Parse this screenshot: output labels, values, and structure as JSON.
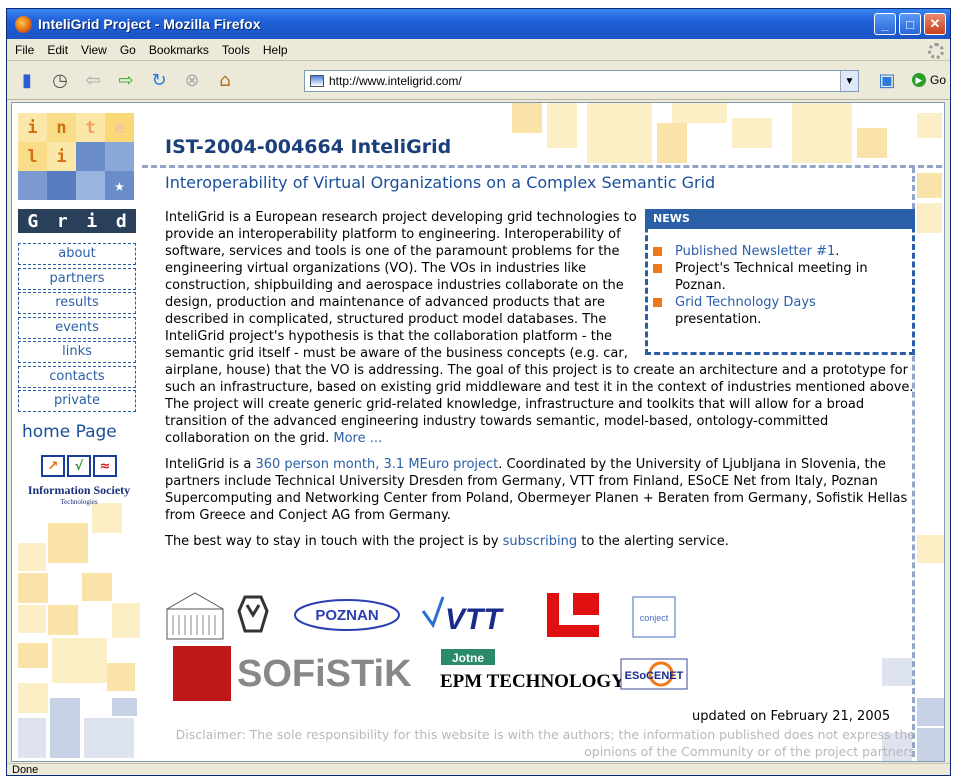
{
  "window": {
    "title": "InteliGrid Project - Mozilla Firefox",
    "min": "_",
    "max": "□",
    "close": "✕"
  },
  "menu": [
    "File",
    "Edit",
    "View",
    "Go",
    "Bookmarks",
    "Tools",
    "Help"
  ],
  "toolbar": {
    "url": "http://www.inteligrid.com/",
    "go_label": "Go"
  },
  "status": "Done",
  "page": {
    "logo_letters": [
      "i",
      "n",
      "t",
      "e",
      "l",
      "i"
    ],
    "grid_letters": [
      "G",
      "r",
      "i",
      "d"
    ],
    "nav": [
      "about",
      "partners",
      "results",
      "events",
      "links",
      "contacts",
      "private"
    ],
    "home": "home Page",
    "ist_line1": "Information Society",
    "ist_line2": "Technologies",
    "title": "IST-2004-004664 InteliGrid",
    "subtitle": "Interoperability of Virtual Organizations on a Complex Semantic Grid",
    "p1": "InteliGrid is a European research project developing grid technologies to provide an interoperability platform to engineering. Interoperability of software, services and tools is one of the paramount problems for the engineering virtual organizations (VO). The VOs in industries like construction, shipbuilding and aerospace industries collaborate on the design, production and maintenance of advanced products that are described in complicated, structured product model databases. The InteliGrid project's hypothesis is that the collaboration platform - the semantic grid itself - must be aware of the business concepts (e.g. car, airplane, house) that the VO is addressing. The goal of this project is to create an architecture and a prototype for such an infrastructure, based on existing grid middleware and test it in the context of industries mentioned above. The project will create generic grid-related knowledge, infrastructure and toolkits that will allow for a broad transition of the advanced engineering industry towards semantic, model-based, ontology-committed collaboration on the grid. ",
    "p1_more": "More ...",
    "p2_a": "InteliGrid is a ",
    "p2_link": "360 person month, 3.1 MEuro project",
    "p2_b": ". Coordinated by the University of Ljubljana in Slovenia, the partners include Technical University Dresden from Germany, VTT from Finland, ESoCE Net from Italy, Poznan Supercomputing and Networking Center from Poland, Obermeyer Planen + Beraten from Germany, Sofistik Hellas from Greece and Conject AG from Germany.",
    "p3_a": "The best way to stay in touch with the project is by ",
    "p3_link": "subscribing",
    "p3_b": " to the alerting service.",
    "news_title": "NEWS",
    "news1_link": "Published Newsletter #1",
    "news1_tail": ".",
    "news2": "Project's Technical meeting in Poznan.",
    "news3_link": "Grid Technology Days",
    "news3_tail": " presentation.",
    "logos": {
      "poznan": "POZNAN",
      "vtt": "VTT",
      "conject": "conject",
      "sofistik": "SOFiSTiK",
      "jotne": "Jotne",
      "epm": "EPM TECHNOLOGY",
      "esocenet": "ESoCENET"
    },
    "updated": "updated on February 21, 2005",
    "disclaimer": "Disclaimer: The sole responsibility for this website is with the authors; the information published does not express the opinions of the Community or of the project partners"
  }
}
